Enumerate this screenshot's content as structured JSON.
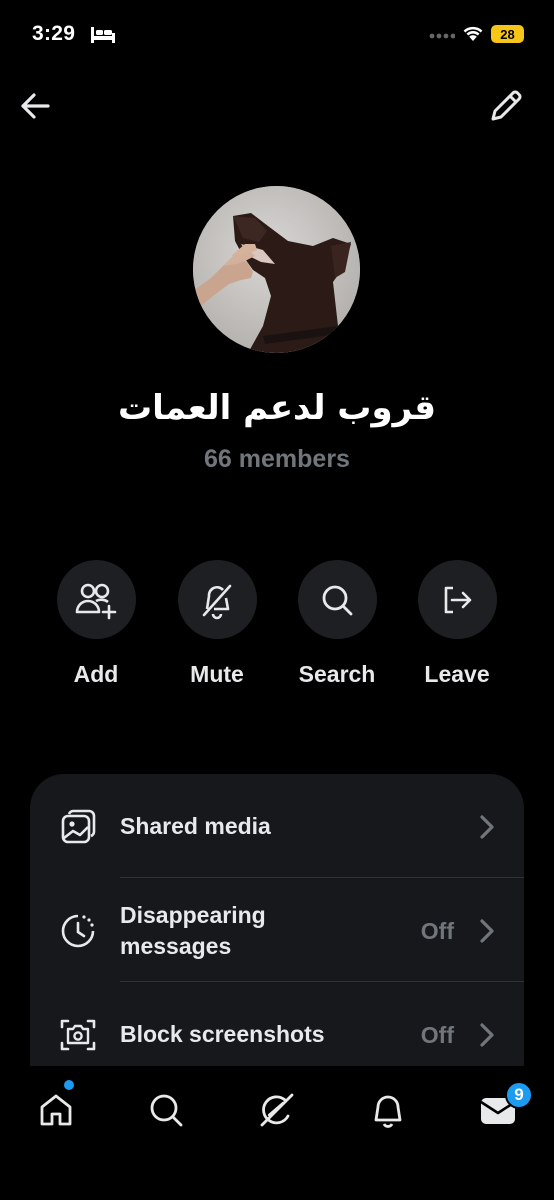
{
  "status_bar": {
    "time": "3:29",
    "battery": "28",
    "icons": [
      "bed-icon",
      "signal-dots-icon",
      "wifi-icon",
      "battery-icon"
    ]
  },
  "header": {
    "back_icon": "arrow-left-icon",
    "edit_icon": "pencil-icon"
  },
  "group": {
    "name": "قروب لدعم العمات",
    "members": "66 members"
  },
  "actions": [
    {
      "label": "Add",
      "icon": "add-people-icon"
    },
    {
      "label": "Mute",
      "icon": "bell-off-icon"
    },
    {
      "label": "Search",
      "icon": "search-icon"
    },
    {
      "label": "Leave",
      "icon": "leave-icon"
    }
  ],
  "settings": [
    {
      "label": "Shared media",
      "value": "",
      "icon": "media-icon"
    },
    {
      "label": "Disappearing messages",
      "line1": "Disappearing",
      "line2": "messages",
      "value": "Off",
      "icon": "timer-icon"
    },
    {
      "label": "Block screenshots",
      "value": "Off",
      "icon": "camera-icon"
    }
  ],
  "nav": {
    "items": [
      "home-icon",
      "search-icon",
      "grok-icon",
      "bell-icon",
      "mail-icon"
    ],
    "messages_badge": "9",
    "accent": "#1d9bf0"
  },
  "colors": {
    "background": "#000000",
    "card": "#17181c",
    "muted": "#71767b",
    "battery": "#f5c518"
  }
}
